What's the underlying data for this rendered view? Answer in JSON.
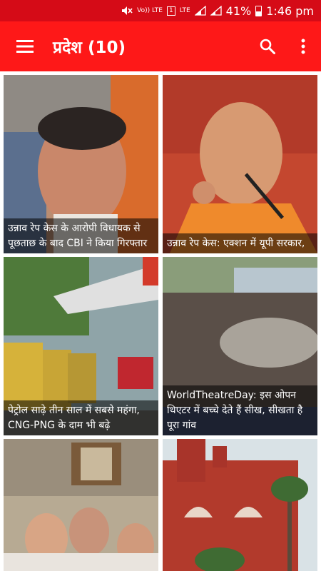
{
  "status_bar": {
    "volte": "Vo)) LTE",
    "sim": "1",
    "lte": "LTE",
    "battery": "41%",
    "time": "1:46 pm"
  },
  "app_bar": {
    "title": "प्रदेश (10)",
    "menu_icon": "hamburger-menu-icon",
    "search_icon": "search-icon",
    "more_icon": "more-vertical-icon"
  },
  "colors": {
    "status_bar": "#d50b17",
    "app_bar": "#fe1818",
    "caption_bg": "rgba(0,0,0,0.55)"
  },
  "cards": [
    {
      "caption": "उन्नाव रेप केस के आरोपी विधायक से पूछताछ के बाद CBI ने किया गिरफ्तार"
    },
    {
      "caption": "उन्नाव रेप केस: एक्शन में यूपी सरकार,"
    },
    {
      "caption": "पेट्रोल साढ़े तीन साल में सबसे महंगा, CNG-PNG के दाम भी बढ़े"
    },
    {
      "caption": "WorldTheatreDay: इस ओपन थिएटर में बच्चे देते हैं सीख, सीखता है पूरा गांव"
    },
    {
      "caption": ""
    },
    {
      "caption": ""
    }
  ]
}
